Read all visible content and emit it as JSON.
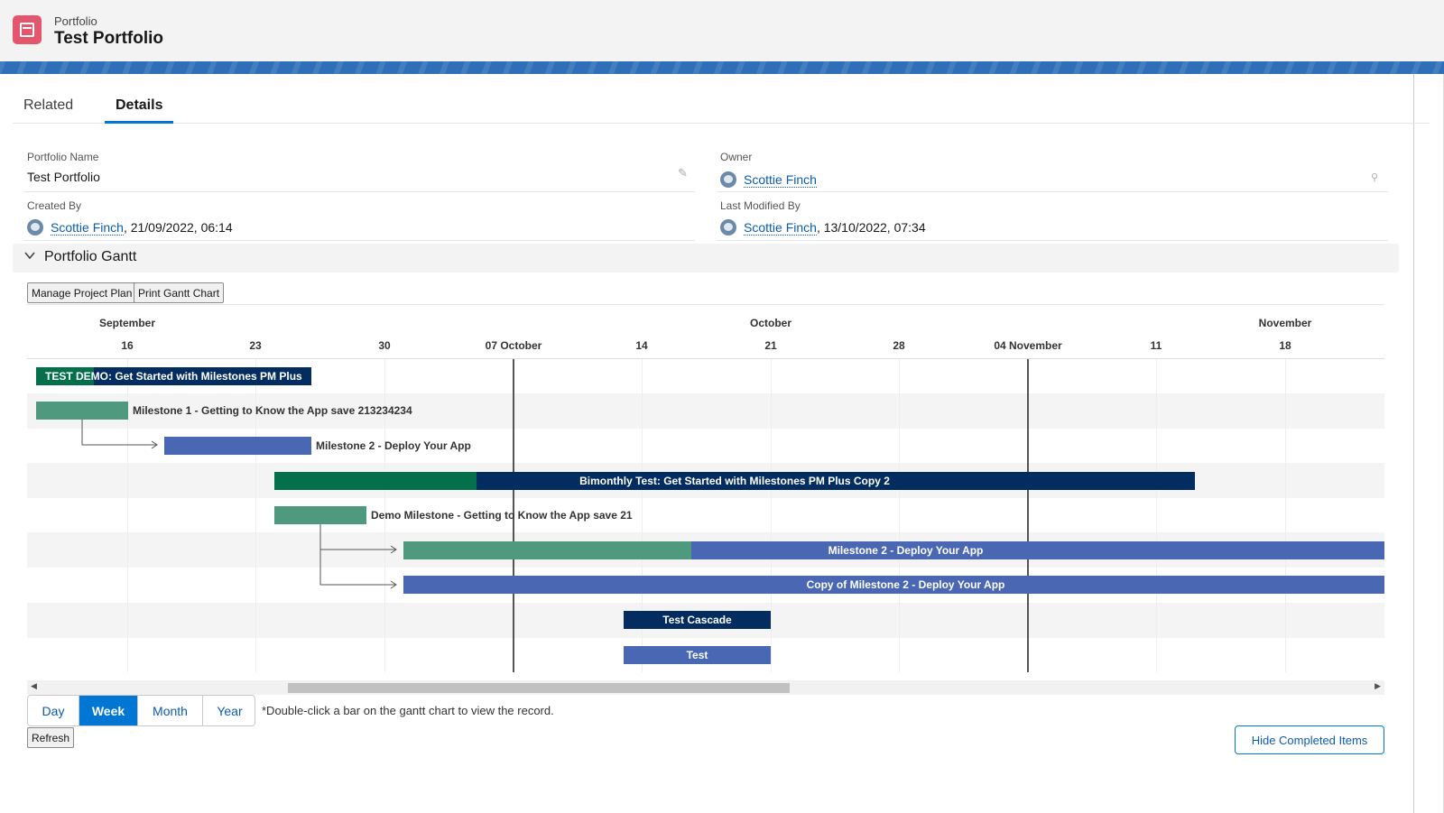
{
  "header": {
    "object_type": "Portfolio",
    "title": "Test Portfolio"
  },
  "tabs": [
    {
      "label": "Related"
    },
    {
      "label": "Details",
      "active": true
    }
  ],
  "fields": {
    "portfolio_name": {
      "label": "Portfolio Name",
      "value": "Test Portfolio"
    },
    "owner": {
      "label": "Owner",
      "value": "Scottie Finch"
    },
    "created_by": {
      "label": "Created By",
      "user": "Scottie Finch",
      "date": "21/09/2022, 06:14"
    },
    "last_modified_by": {
      "label": "Last Modified By",
      "user": "Scottie Finch",
      "date": "13/10/2022, 07:34"
    }
  },
  "section": {
    "title": "Portfolio Gantt"
  },
  "toolbar": {
    "manage": "Manage Project Plan",
    "print": "Print Gantt Chart"
  },
  "gantt": {
    "months": [
      "September",
      "October",
      "November"
    ],
    "weeks": [
      "16",
      "23",
      "30",
      "07 October",
      "14",
      "21",
      "28",
      "04 November",
      "11",
      "18"
    ],
    "bars": [
      {
        "label": "TEST DEMO: Get Started with Milestones PM Plus",
        "progress": 0.21,
        "color": "#032d60",
        "fill_color": "#04704b"
      },
      {
        "label": "Milestone 1 - Getting to Know the App save 213234234",
        "color": "#4f9a7f"
      },
      {
        "label": "Milestone 2 - Deploy Your App",
        "color": "#4a67b3"
      },
      {
        "label": "Bimonthly Test: Get Started with Milestones PM Plus Copy 2",
        "progress": 0.22,
        "color": "#032d60",
        "fill_color": "#04704b"
      },
      {
        "label": "Demo Milestone - Getting to Know the App save 21",
        "color": "#4f9a7f"
      },
      {
        "label": "Milestone 2 - Deploy Your App",
        "progress": 0.29,
        "color": "#4a67b3",
        "fill_color": "#4f9a7f"
      },
      {
        "label": "Copy of Milestone 2 - Deploy Your App",
        "color": "#4a67b3"
      },
      {
        "label": "Test Cascade",
        "color": "#032d60"
      },
      {
        "label": "Test",
        "color": "#4a67b3"
      }
    ]
  },
  "view_modes": [
    {
      "label": "Day"
    },
    {
      "label": "Week",
      "active": true
    },
    {
      "label": "Month"
    },
    {
      "label": "Year"
    }
  ],
  "note": "*Double-click a bar on the gantt chart to view the record.",
  "refresh": "Refresh",
  "hide_completed": "Hide Completed Items"
}
